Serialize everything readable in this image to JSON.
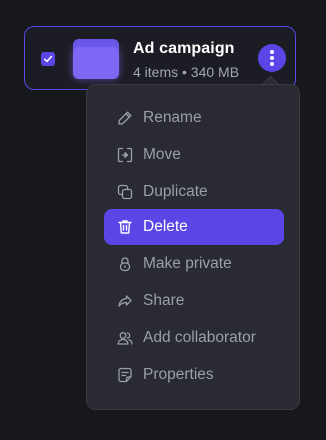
{
  "item": {
    "name": "Ad campaign",
    "meta": "4 items • 340 MB",
    "selected": true
  },
  "menu": {
    "items": [
      {
        "label": "Rename",
        "icon": "pencil-icon"
      },
      {
        "label": "Move",
        "icon": "move-icon"
      },
      {
        "label": "Duplicate",
        "icon": "duplicate-icon"
      },
      {
        "label": "Delete",
        "icon": "trash-icon",
        "active": true
      },
      {
        "label": "Make private",
        "icon": "lock-icon"
      },
      {
        "label": "Share",
        "icon": "share-icon"
      },
      {
        "label": "Add collaborator",
        "icon": "users-icon"
      },
      {
        "label": "Properties",
        "icon": "properties-icon"
      }
    ]
  },
  "colors": {
    "accent": "#5a46e6",
    "background": "#17181c",
    "menu_bg": "#292a32",
    "muted_text": "#9c9ea8"
  }
}
